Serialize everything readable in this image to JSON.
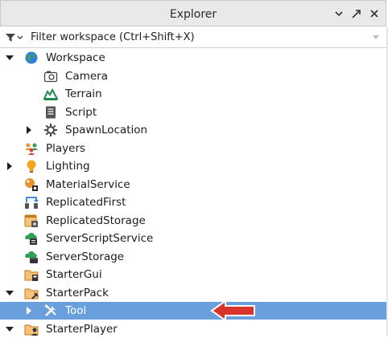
{
  "panel": {
    "title": "Explorer",
    "filter_placeholder": "Filter workspace (Ctrl+Shift+X)"
  },
  "tree": [
    {
      "label": "Workspace",
      "icon": "globe-icon"
    },
    {
      "label": "Camera",
      "icon": "camera-icon"
    },
    {
      "label": "Terrain",
      "icon": "terrain-icon"
    },
    {
      "label": "Script",
      "icon": "script-icon"
    },
    {
      "label": "SpawnLocation",
      "icon": "spawn-location-icon"
    },
    {
      "label": "Players",
      "icon": "players-icon"
    },
    {
      "label": "Lighting",
      "icon": "lightbulb-icon"
    },
    {
      "label": "MaterialService",
      "icon": "material-service-icon"
    },
    {
      "label": "ReplicatedFirst",
      "icon": "replicated-first-icon"
    },
    {
      "label": "ReplicatedStorage",
      "icon": "replicated-storage-icon"
    },
    {
      "label": "ServerScriptService",
      "icon": "server-script-service-icon"
    },
    {
      "label": "ServerStorage",
      "icon": "server-storage-icon"
    },
    {
      "label": "StarterGui",
      "icon": "starter-gui-icon"
    },
    {
      "label": "StarterPack",
      "icon": "starter-pack-icon"
    },
    {
      "label": "Tool",
      "icon": "tool-icon",
      "selected": true
    },
    {
      "label": "StarterPlayer",
      "icon": "starter-player-icon"
    }
  ],
  "colors": {
    "selection": "#6a9fde",
    "annotation_arrow": "#d9342b"
  }
}
